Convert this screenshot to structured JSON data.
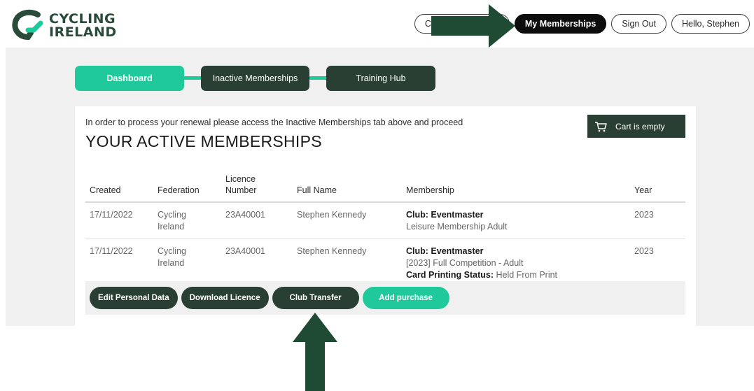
{
  "brand": {
    "line1": "CYCLING",
    "line2": "IRELAND",
    "color": "#2a4a3a",
    "accent": "#1fc99b"
  },
  "top_nav": {
    "clubs_label": "Cl",
    "memberships_label": "My Memberships",
    "sign_out_label": "Sign Out",
    "greeting": "Hello, Stephen"
  },
  "steps": [
    {
      "label": "Dashboard",
      "active": true
    },
    {
      "label": "Inactive Memberships",
      "active": false
    },
    {
      "label": "Training Hub",
      "active": false
    }
  ],
  "main": {
    "notice": "In order to process your renewal please access the Inactive Memberships tab above and proceed",
    "title": "YOUR ACTIVE MEMBERSHIPS",
    "cart_label": "Cart is empty"
  },
  "table": {
    "headers": {
      "created": "Created",
      "federation": "Federation",
      "licence_line1": "Licence",
      "licence_line2": "Number",
      "full_name": "Full Name",
      "membership": "Membership",
      "year": "Year"
    },
    "rows": [
      {
        "created": "17/11/2022",
        "federation_line1": "Cycling",
        "federation_line2": "Ireland",
        "licence": "23A40001",
        "full_name": "Stephen Kennedy",
        "club": "Club: Eventmaster",
        "membership_type": "Leisure Membership Adult",
        "year": "2023"
      },
      {
        "created": "17/11/2022",
        "federation_line1": "Cycling",
        "federation_line2": "Ireland",
        "licence": "23A40001",
        "full_name": "Stephen Kennedy",
        "club": "Club: Eventmaster",
        "membership_type": "[2023] Full Competition - Adult",
        "print_status_label": "Card Printing Status:",
        "print_status_value": "Held From Print",
        "year": "2023"
      }
    ]
  },
  "actions": {
    "edit_personal": "Edit Personal Data",
    "download_licence": "Download Licence",
    "club_transfer": "Club Transfer",
    "add_purchase": "Add purchase"
  },
  "annotation_color": "#1f4a33"
}
